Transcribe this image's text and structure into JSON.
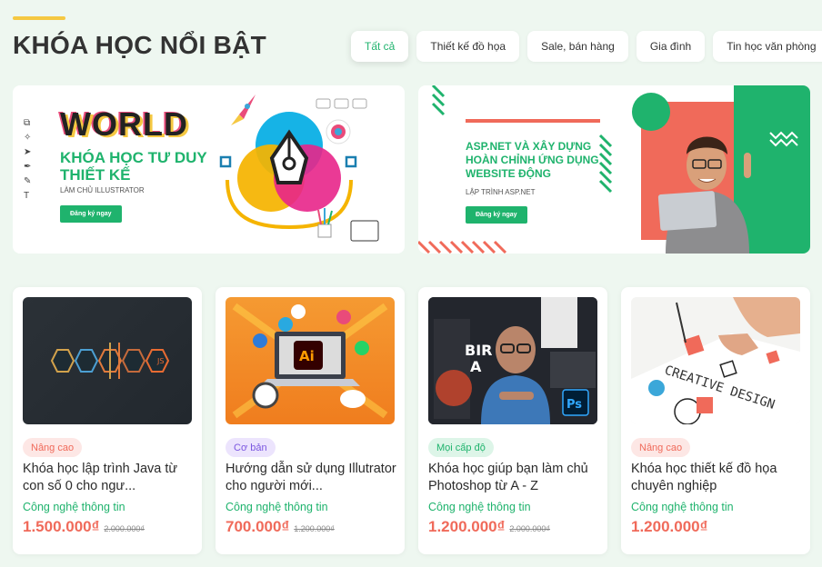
{
  "header": {
    "title": "KHÓA HỌC NỔI BẬT"
  },
  "tabs": [
    {
      "label": "Tất cả",
      "active": true
    },
    {
      "label": "Thiết kế đồ họa"
    },
    {
      "label": "Sale, bán hàng"
    },
    {
      "label": "Gia đình"
    },
    {
      "label": "Tin học văn phòng"
    }
  ],
  "banners": [
    {
      "logo_text": "WORLD",
      "headline": "KHÓA HỌC TƯ DUY THIẾT KẾ",
      "subtitle": "LÀM CHỦ ILLUSTRATOR",
      "cta": "Đăng ký ngay"
    },
    {
      "headline": "ASP.NET VÀ XÂY DỰNG HOÀN CHỈNH ỨNG DỤNG WEBSITE ĐỘNG",
      "subtitle": "LẬP TRÌNH ASP.NET",
      "cta": "Đăng ký ngay"
    }
  ],
  "courses": [
    {
      "level": "Nâng cao",
      "title": "Khóa học lập trình Java từ con số 0 cho ngư...",
      "category": "Công nghệ thông tin",
      "price": "1.500.000₫",
      "old_price": "2.000.000₫",
      "thumb_text": "JS"
    },
    {
      "level": "Cơ bản",
      "title": "Hướng dẫn sử dụng Illutrator cho người mới...",
      "category": "Công nghệ thông tin",
      "price": "700.000₫",
      "old_price": "1.200.000₫",
      "thumb_text": "Ai"
    },
    {
      "level": "Mọi cấp độ",
      "title": "Khóa học giúp bạn làm chủ Photoshop từ A - Z",
      "category": "Công nghệ thông tin",
      "price": "1.200.000₫",
      "old_price": "2.000.000₫",
      "thumb_text": "Ps"
    },
    {
      "level": "Nâng cao",
      "title": "Khóa học thiết kế đồ họa chuyên nghiệp",
      "category": "Công nghệ thông tin",
      "price": "1.200.000₫",
      "old_price": "",
      "thumb_text": "CREATIVE DESIGN"
    }
  ],
  "colors": {
    "accent": "#1fb36d",
    "price": "#f06a5a",
    "highlight": "#f5c842",
    "background": "#eef7f0"
  }
}
